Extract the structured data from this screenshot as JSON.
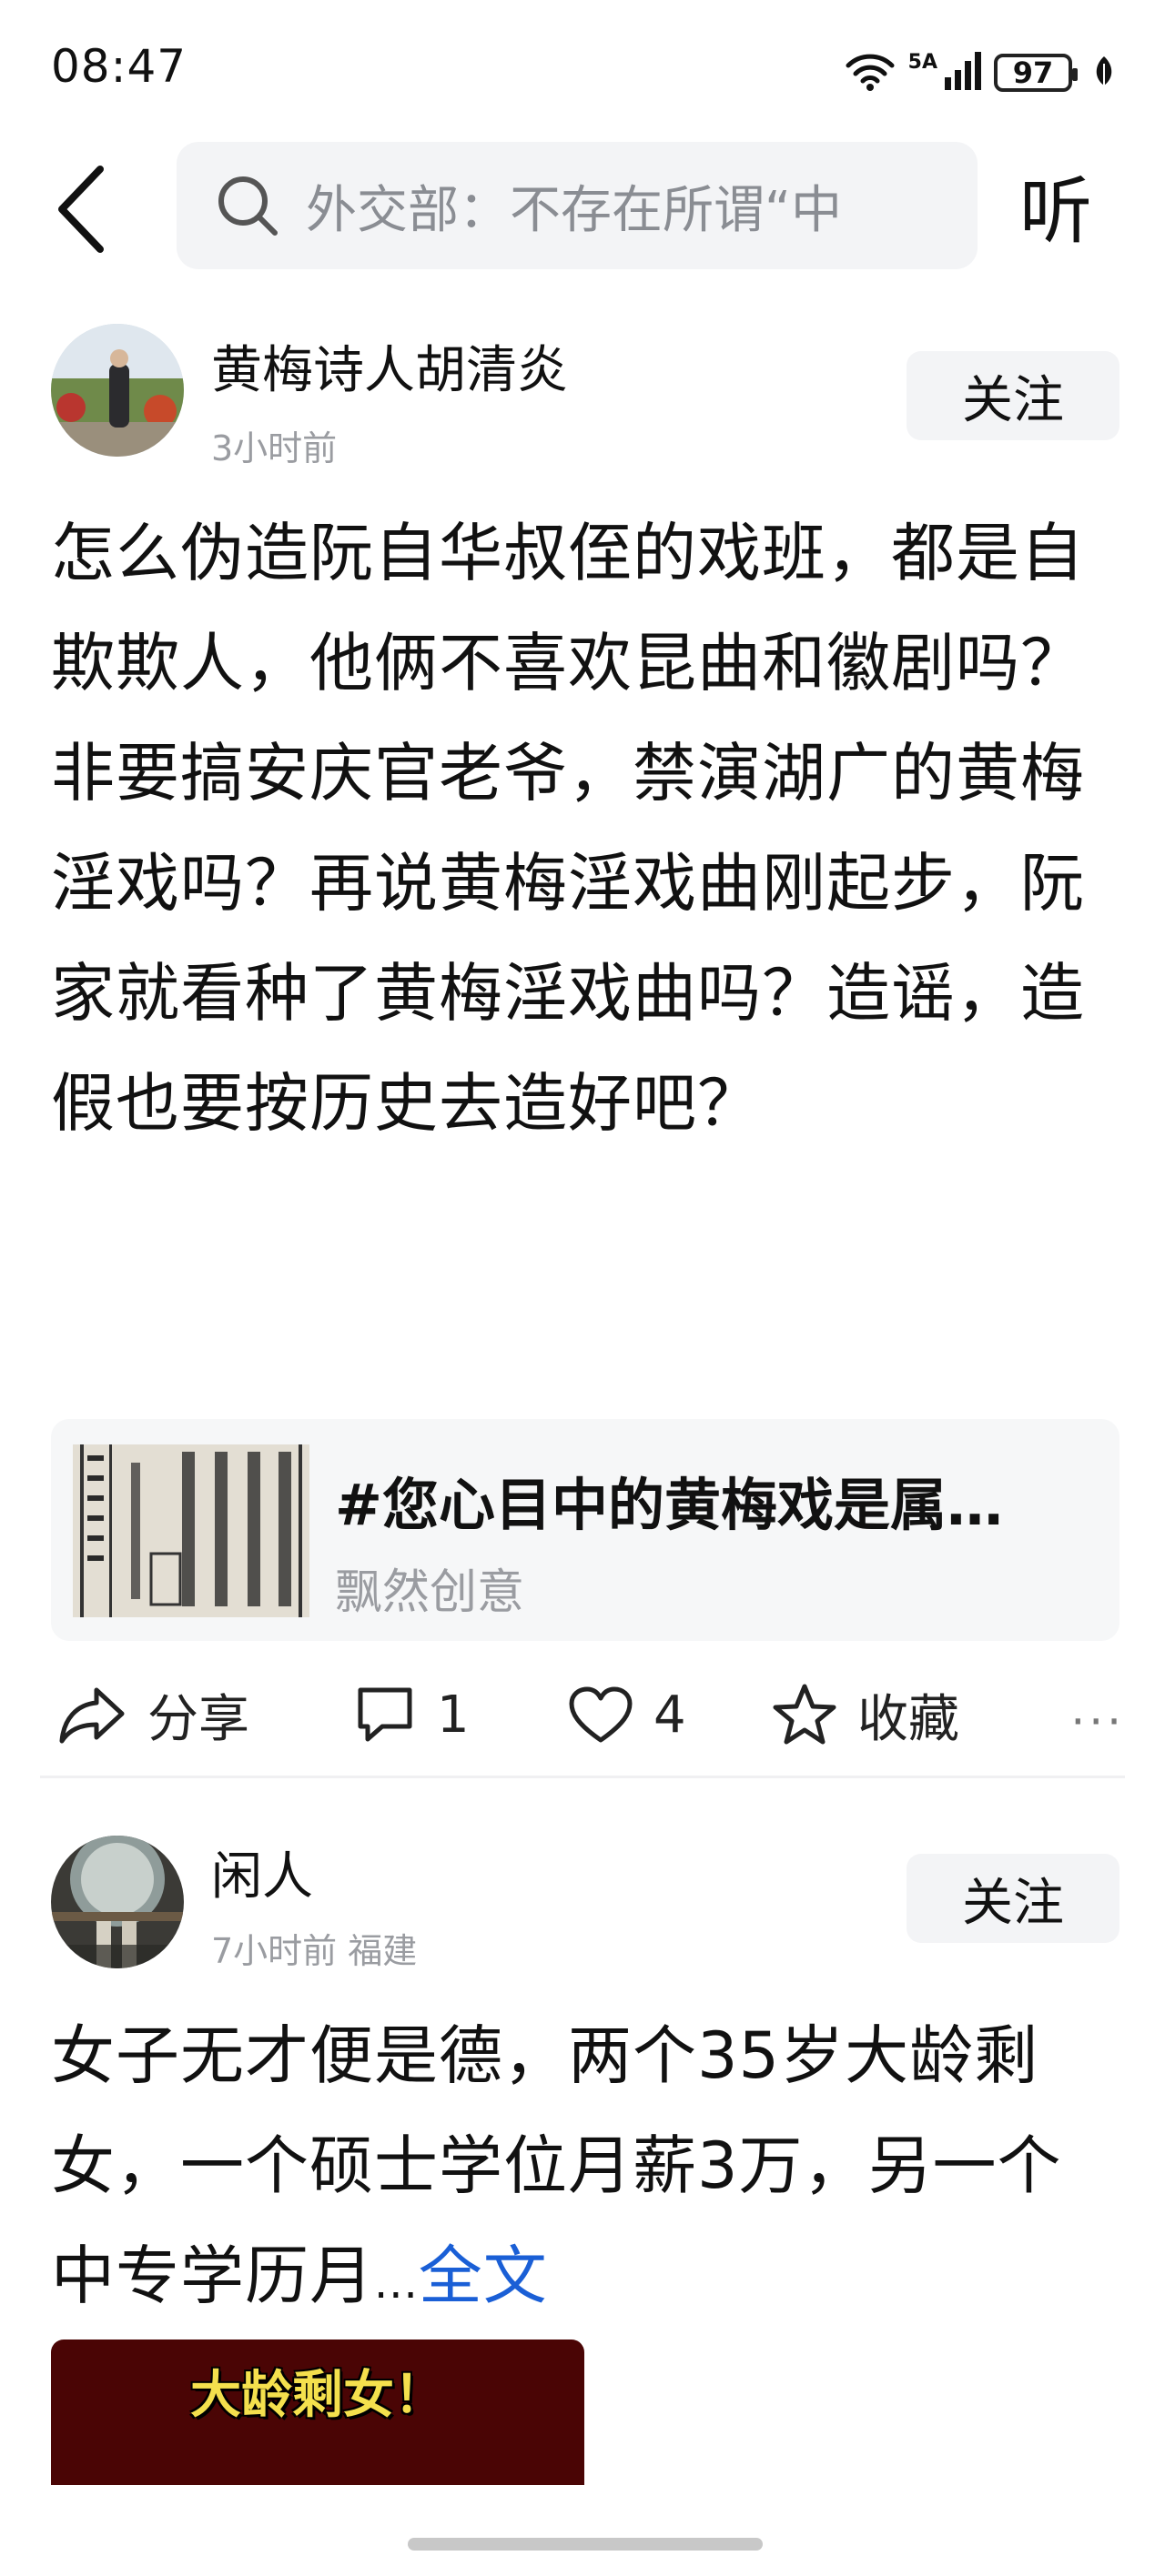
{
  "status_bar": {
    "time": "08:47",
    "network": "5A",
    "battery": "97",
    "icons": [
      "wifi-icon",
      "signal-icon",
      "battery-icon",
      "leaf-icon"
    ]
  },
  "header": {
    "back_icon": "chevron-left-icon",
    "search_icon": "search-icon",
    "search_placeholder": "外交部：不存在所谓“中",
    "listen_label": "听"
  },
  "posts": [
    {
      "author": "黄梅诗人胡清炎",
      "meta": "3小时前",
      "follow_label": "关注",
      "body": "怎么伪造阮自华叔侄的戏班，都是自欺欺人，他俩不喜欢昆曲和徽剧吗？非要搞安庆官老爷，禁演湖广的黄梅淫戏吗？再说黄梅淫戏曲刚起步，阮家就看种了黄梅淫戏曲吗？造谣，造假也要按历史去造好吧？",
      "topic": {
        "title": "#您心目中的黄梅戏是属…",
        "source": "飘然创意"
      },
      "actions": {
        "share_label": "分享",
        "comment_count": "1",
        "like_count": "4",
        "favorite_label": "收藏",
        "more_label": "···"
      }
    },
    {
      "author": "闲人",
      "meta": "7小时前 福建",
      "follow_label": "关注",
      "body": "女子无才便是德，两个35岁大龄剩女，一个硕士学位月薪3万，另一个中专学历月",
      "ellipsis": "...",
      "full_text_label": "全文",
      "video_caption": "大龄剩女！"
    }
  ]
}
